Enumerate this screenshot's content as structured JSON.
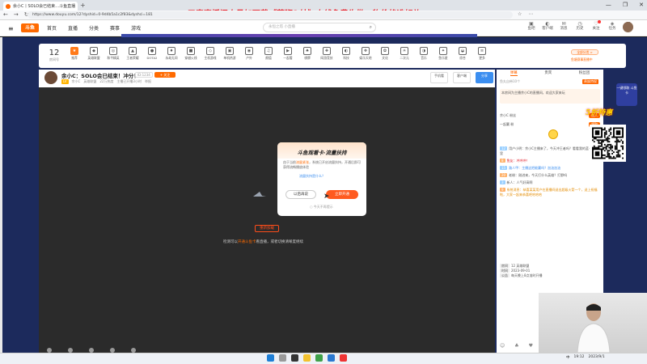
{
  "browser": {
    "tab_title": "余小C丨SOLO会已结束…斗鱼直播",
    "newtab_label": "+",
    "url": "https://www.douyu.com/12?dyshid=0-9d4b5a1c2f83&dyshci=181",
    "controls": [
      "—",
      "❐",
      "✕"
    ],
    "nav": [
      "←",
      "→",
      "↻"
    ],
    "icons": [
      "☆",
      "⋯"
    ]
  },
  "banner_text": "五毒直播间小号加下载《蓝狮Q坊》上线免费牛批，物价格选好礼",
  "site": {
    "logo": "斗鱼",
    "menu_icon": "≡",
    "nav": [
      "首页",
      "直播",
      "分类",
      "赛事",
      "游戏"
    ],
    "search_placeholder": "永恒之塔 小直播",
    "search_icon": "⌕",
    "user_icons": [
      {
        "glyph": "▣",
        "label": "鱼吧"
      },
      {
        "glyph": "◐",
        "label": "客户端"
      },
      {
        "glyph": "✉",
        "label": "消息"
      },
      {
        "glyph": "◷",
        "label": "历史"
      },
      {
        "glyph": "♡",
        "label": "关注"
      },
      {
        "glyph": "◈",
        "label": "任务"
      },
      {
        "glyph": "▤",
        "label": "开播"
      }
    ]
  },
  "categories": {
    "room_num": "12",
    "room_label": "房间号",
    "items": [
      {
        "icon": "★",
        "label": "推荐",
        "active": true
      },
      {
        "icon": "◆",
        "label": "英雄联盟"
      },
      {
        "icon": "◎",
        "label": "和平精英"
      },
      {
        "icon": "▲",
        "label": "王者荣耀"
      },
      {
        "icon": "●",
        "label": "DOTA2"
      },
      {
        "icon": "♦",
        "label": "永劫无间"
      },
      {
        "icon": "■",
        "label": "穿越火线"
      },
      {
        "icon": "◇",
        "label": "主机游戏"
      },
      {
        "icon": "▣",
        "label": "单机热游"
      },
      {
        "icon": "◉",
        "label": "户外"
      },
      {
        "icon": "♫",
        "label": "颜值"
      },
      {
        "icon": "▶",
        "label": "一起看"
      },
      {
        "icon": "♠",
        "label": "棋牌"
      },
      {
        "icon": "✚",
        "label": "网游竞技"
      },
      {
        "icon": "◐",
        "label": "科技"
      },
      {
        "icon": "❖",
        "label": "娱乐天地"
      },
      {
        "icon": "✿",
        "label": "文化"
      },
      {
        "icon": "☀",
        "label": "二次元"
      },
      {
        "icon": "◑",
        "label": "音乐"
      },
      {
        "icon": "✦",
        "label": "鱼乐星"
      },
      {
        "icon": "◒",
        "label": "综合"
      },
      {
        "icon": "≡",
        "label": "更多"
      }
    ],
    "more_label": "全部分类 >",
    "more_sub": "鱼塘赛事直播中"
  },
  "streamer": {
    "title": "余小C：SOLO会已结束！冲分！",
    "id_badge": "ID:1234",
    "follow": "+ 关注",
    "level": "LV",
    "meta": [
      "余小C",
      "英雄联盟",
      "22万热度",
      "主播已开播3小时",
      "举报"
    ],
    "btns": [
      "手机看",
      "客户端",
      "分享"
    ]
  },
  "player": {
    "retry": "重新加载",
    "message_pre": "检测可以",
    "message_hl": "开通斗鱼卡",
    "message_post": "看直播，或者切换清晰度继续"
  },
  "popup": {
    "title": "斗鱼观看卡·流量扶持",
    "body_pre": "由于当前",
    "body_hl": "流量紧张",
    "body_post": "，系统已开启流量扶持，开通后即可获得流畅播放体验",
    "link": "流量扶持是什么？",
    "cancel": "以后再说",
    "ok": "立即开通",
    "checkbox": "今天不再提示"
  },
  "chat": {
    "tabs": [
      "弹幕",
      "贵宾",
      "粉丝团"
    ],
    "top_text": "鱼丸自带10个",
    "top_btn": "贵族特权",
    "pinned": "本房间为主播余小C的直播间，欢迎大家来玩",
    "fans": [
      {
        "name": "余小C 粉丝",
        "btn": "加入"
      },
      {
        "name": "一起赢 粉",
        "btn": "领取"
      }
    ],
    "messages": [
      {
        "tag": "12",
        "color": "",
        "text": "用户小明：余小C主播来了，今天冲王者吗？看看我的蓝卡在哪里"
      },
      {
        "tag": "8",
        "color": "red",
        "text": "鱼友：冲冲冲！"
      },
      {
        "tag": "15",
        "color": "blue",
        "text": "路人甲：主播这把能赢吗？加油加油"
      },
      {
        "tag": "20",
        "color": "",
        "text": "老粉：刚进来，今天打什么英雄？打野吗"
      },
      {
        "tag": "3",
        "color": "",
        "text": "新人：人气好高啊"
      },
      {
        "tag": "9",
        "color": "gold",
        "text": "系统消息：恭喜某某用户在直播间送出超级火箭一个，送上祝福啦，大家一起来恭喜吧哈哈哈"
      }
    ],
    "info": [
      {
        "k": "房间",
        "v": "12 英雄联盟"
      },
      {
        "k": "时间",
        "v": "2023-09-01"
      },
      {
        "k": "公告",
        "v": "每天晚上8点准时开播"
      }
    ],
    "bottom_icons": [
      "☺",
      "♣",
      "♥"
    ]
  },
  "promo": {
    "badge": "一键领取 斗鱼卡",
    "slogan": "5折特惠"
  },
  "taskbar": {
    "time": "19:12",
    "date": "2023/9/1",
    "lang": "中"
  }
}
